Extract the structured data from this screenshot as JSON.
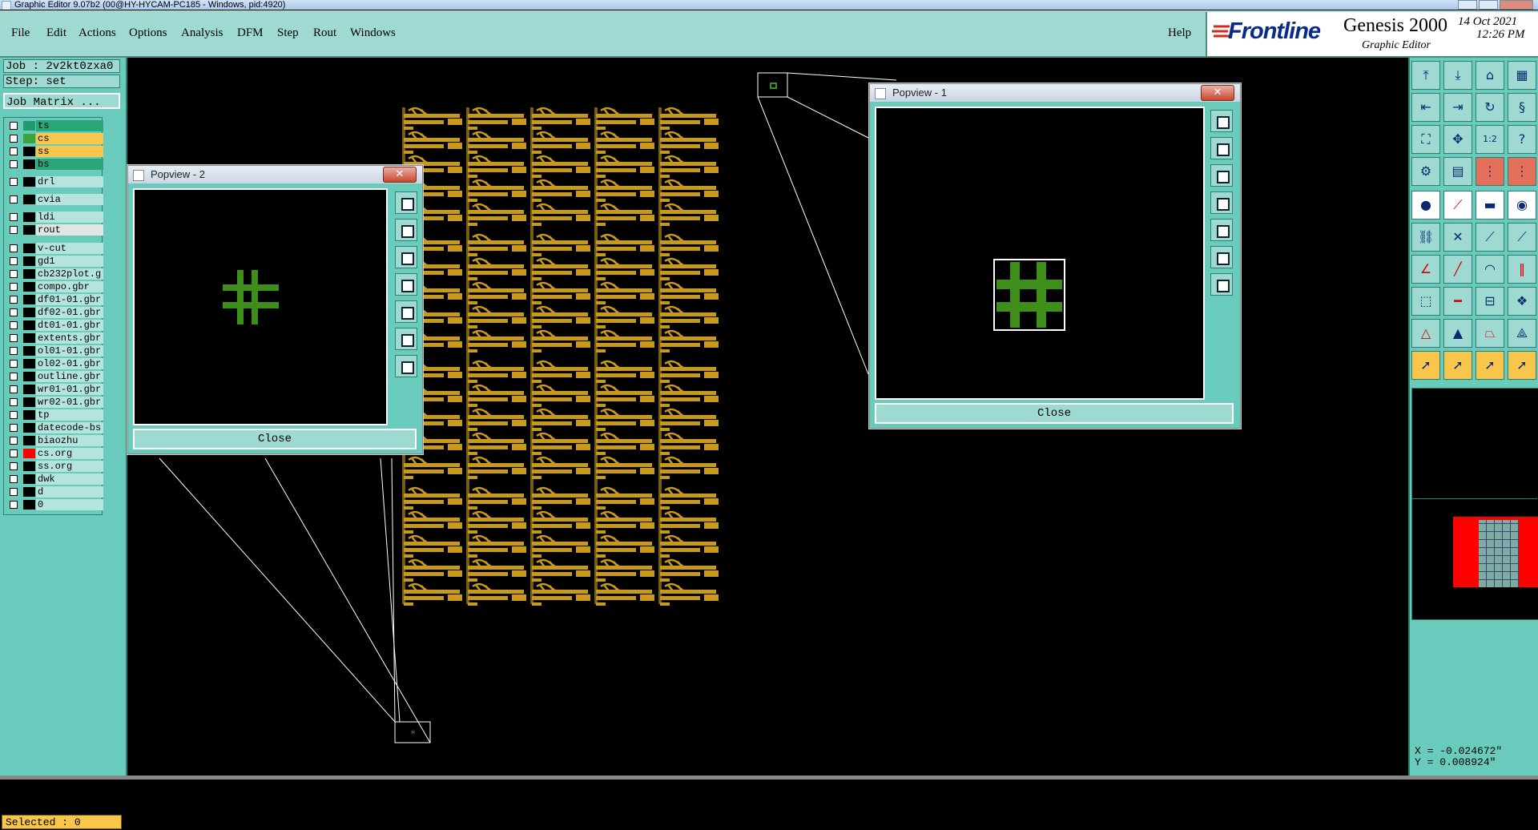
{
  "window": {
    "title": "Graphic Editor 9.07b2 (00@HY-HYCAM-PC185 - Windows, pid:4920)"
  },
  "menu": {
    "items": [
      "File",
      "Edit",
      "Actions",
      "Options",
      "Analysis",
      "DFM",
      "Step",
      "Rout",
      "Windows"
    ],
    "help": "Help"
  },
  "brand": {
    "logo": "Frontline",
    "product": "Genesis 2000",
    "subtitle": "Graphic Editor",
    "date": "14 Oct 2021",
    "time": "12:26 PM"
  },
  "job": {
    "job_label": "Job : 2v2kt0zxa0",
    "step_label": "Step: set",
    "matrix_button": "Job Matrix ..."
  },
  "layers": [
    {
      "name": "ts",
      "color": "#1f9b6e",
      "bg": "#2aa67a"
    },
    {
      "name": "cs",
      "color": "#3aa53a",
      "bg": "#f8c64a"
    },
    {
      "name": "ss",
      "color": "#000000",
      "bg": "#f8c64a"
    },
    {
      "name": "bs",
      "color": "#000000",
      "bg": "#2aa67a"
    },
    {
      "name": "drl",
      "color": "#000000",
      "bg": "#b5e4de"
    },
    {
      "name": "cvia",
      "color": "#000000",
      "bg": "#b5e4de"
    },
    {
      "name": "ldi",
      "color": "#000000",
      "bg": "#b5e4de"
    },
    {
      "name": "rout",
      "color": "#000000",
      "bg": "#dfe6e4"
    },
    {
      "name": "v-cut",
      "color": "#000000",
      "bg": "#b5e4de"
    },
    {
      "name": "gd1",
      "color": "#000000",
      "bg": "#b5e4de"
    },
    {
      "name": "cb232plot.g",
      "color": "#000000",
      "bg": "#b5e4de"
    },
    {
      "name": "compo.gbr",
      "color": "#000000",
      "bg": "#b5e4de"
    },
    {
      "name": "df01-01.gbr",
      "color": "#000000",
      "bg": "#b5e4de"
    },
    {
      "name": "df02-01.gbr",
      "color": "#000000",
      "bg": "#b5e4de"
    },
    {
      "name": "dt01-01.gbr",
      "color": "#000000",
      "bg": "#b5e4de"
    },
    {
      "name": "extents.gbr",
      "color": "#000000",
      "bg": "#b5e4de"
    },
    {
      "name": "ol01-01.gbr",
      "color": "#000000",
      "bg": "#b5e4de"
    },
    {
      "name": "ol02-01.gbr",
      "color": "#000000",
      "bg": "#b5e4de"
    },
    {
      "name": "outline.gbr",
      "color": "#000000",
      "bg": "#b5e4de"
    },
    {
      "name": "wr01-01.gbr",
      "color": "#000000",
      "bg": "#b5e4de"
    },
    {
      "name": "wr02-01.gbr",
      "color": "#000000",
      "bg": "#b5e4de"
    },
    {
      "name": "tp",
      "color": "#000000",
      "bg": "#b5e4de"
    },
    {
      "name": "datecode-bs",
      "color": "#000000",
      "bg": "#b5e4de"
    },
    {
      "name": "biaozhu",
      "color": "#000000",
      "bg": "#b5e4de"
    },
    {
      "name": "cs.org",
      "color": "#ff0000",
      "bg": "#b5e4de"
    },
    {
      "name": "ss.org",
      "color": "#000000",
      "bg": "#b5e4de"
    },
    {
      "name": "dwk",
      "color": "#000000",
      "bg": "#b5e4de"
    },
    {
      "name": "d",
      "color": "#000000",
      "bg": "#b5e4de"
    },
    {
      "name": "0",
      "color": "#000000",
      "bg": "#b5e4de"
    }
  ],
  "selected": "Selected : 0",
  "popview2": {
    "title": "Popview - 2",
    "close": "Close"
  },
  "popview1": {
    "title": "Popview - 1",
    "close": "Close"
  },
  "coords": {
    "x": "X = -0.024672\"",
    "y": "Y = 0.008924\""
  },
  "colors": {
    "teal": "#69cbbc",
    "light_teal": "#9ed9d2",
    "copper": "#c79a1f",
    "green_feature": "#3d8f1a",
    "red": "#ff0000"
  }
}
